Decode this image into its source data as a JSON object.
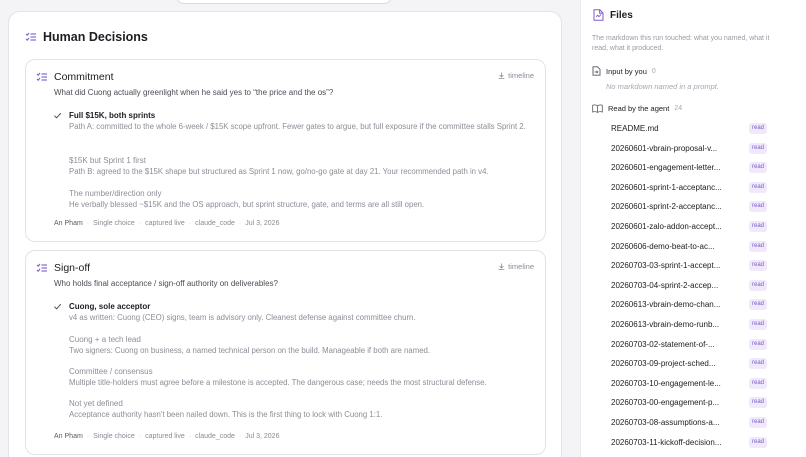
{
  "decisions": {
    "title": "Human Decisions",
    "icon": "list-check-icon",
    "cards": [
      {
        "title": "Commitment",
        "question": "What did Cuong actually greenlight when he said yes to “the price and the os”?",
        "timeline_label": "timeline",
        "options": [
          {
            "label": "Full $15K, both sprints",
            "desc": "Path A: committed to the whole 6-week / $15K scope upfront. Fewer gates to argue, but full exposure if the committee stalls Sprint 2.",
            "selected": true
          },
          {
            "label": "$15K but Sprint 1 first",
            "desc": "Path B: agreed to the $15K shape but structured as Sprint 1 now, go/no-go gate at day 21. Your recommended path in v4.",
            "selected": false
          },
          {
            "label": "The number/direction only",
            "desc": "He verbally blessed ~$15K and the OS approach, but sprint structure, gate, and terms are all still open.",
            "selected": false
          }
        ],
        "meta": {
          "author": "An Pham",
          "type": "Single choice",
          "capture": "captured live",
          "agent": "claude_code",
          "date": "Jul 3, 2026"
        }
      },
      {
        "title": "Sign-off",
        "question": "Who holds final acceptance / sign-off authority on deliverables?",
        "timeline_label": "timeline",
        "options": [
          {
            "label": "Cuong, sole acceptor",
            "desc": "v4 as written: Cuong (CEO) signs, team is advisory only. Cleanest defense against committee churn.",
            "selected": true
          },
          {
            "label": "Cuong + a tech lead",
            "desc": "Two signers: Cuong on business, a named technical person on the build. Manageable if both are named.",
            "selected": false
          },
          {
            "label": "Committee / consensus",
            "desc": "Multiple title-holders must agree before a milestone is accepted. The dangerous case; needs the most structural defense.",
            "selected": false
          },
          {
            "label": "Not yet defined",
            "desc": "Acceptance authority hasn't been nailed down. This is the first thing to lock with Cuong 1:1.",
            "selected": false
          }
        ],
        "meta": {
          "author": "An Pham",
          "type": "Single choice",
          "capture": "captured live",
          "agent": "claude_code",
          "date": "Jul 3, 2026"
        }
      }
    ]
  },
  "files": {
    "title": "Files",
    "subtitle": "The markdown this run touched: what you named, what it read, what it produced.",
    "input_group": {
      "label": "Input by you",
      "count": "0",
      "empty": "No markdown named in a prompt."
    },
    "read_group": {
      "label": "Read by the agent",
      "count": "24",
      "badge": "read",
      "items": [
        "README.md",
        "20260601-vbrain-proposal-v...",
        "20260601-engagement-letter...",
        "20260601-sprint-1-acceptanc...",
        "20260601-sprint-2-acceptanc...",
        "20260601-zalo-addon-accept...",
        "20260606-demo-beat-to-ac...",
        "20260703-03-sprint-1-accept...",
        "20260703-04-sprint-2-accep...",
        "20260613-vbrain-demo-chan...",
        "20260613-vbrain-demo-runb...",
        "20260703-02-statement-of-...",
        "20260703-09-project-sched...",
        "20260703-10-engagement-le...",
        "20260703-00-engagement-p...",
        "20260703-08-assumptions-a...",
        "20260703-11-kickoff-decision..."
      ]
    }
  },
  "colors": {
    "accent": "#7b5cc9",
    "badge_bg": "#efe9fb"
  }
}
